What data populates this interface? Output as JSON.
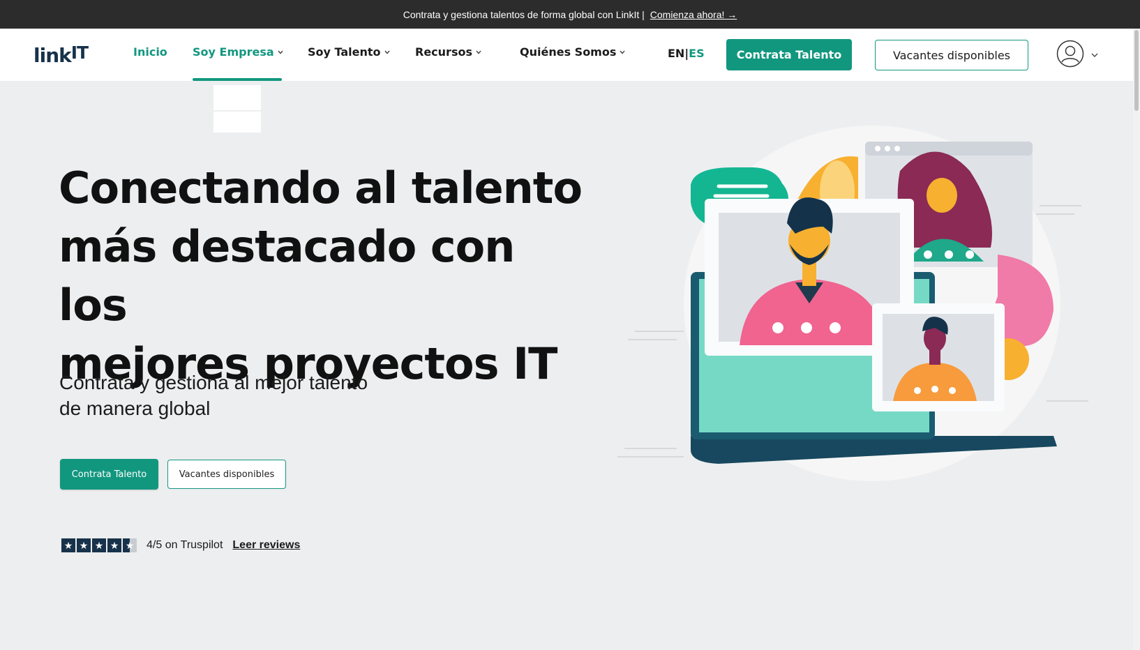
{
  "announcement": {
    "text": "Contrata y gestiona talentos de forma global con LinkIt |",
    "link": "Comienza ahora! →"
  },
  "nav": {
    "logo_link": "link",
    "logo_it": "IT",
    "items": [
      {
        "label": "Inicio"
      },
      {
        "label": "Soy Empresa"
      },
      {
        "label": "Soy Talento"
      },
      {
        "label": "Recursos"
      },
      {
        "label": "Quiénes Somos"
      }
    ],
    "lang_en": "EN",
    "lang_sep": "|",
    "lang_es": "ES",
    "cta_primary": "Contrata Talento",
    "cta_secondary": "Vacantes disponibles"
  },
  "hero": {
    "headline_line1": "Conectando al talento",
    "headline_line2": "más destacado con los",
    "headline_line3": "mejores proyectos IT",
    "sub_line1": "Contrata y gestiona al mejor talento",
    "sub_line2": "de manera global",
    "btn_primary": "Contrata Talento",
    "btn_secondary": "Vacantes disponibles",
    "rating": 4,
    "rating_max": 5,
    "rating_text": "4/5 on Truspilot",
    "reviews_link": "Leer reviews"
  },
  "colors": {
    "accent": "#12977f",
    "dark": "#17324a",
    "bg": "#edeeef"
  }
}
